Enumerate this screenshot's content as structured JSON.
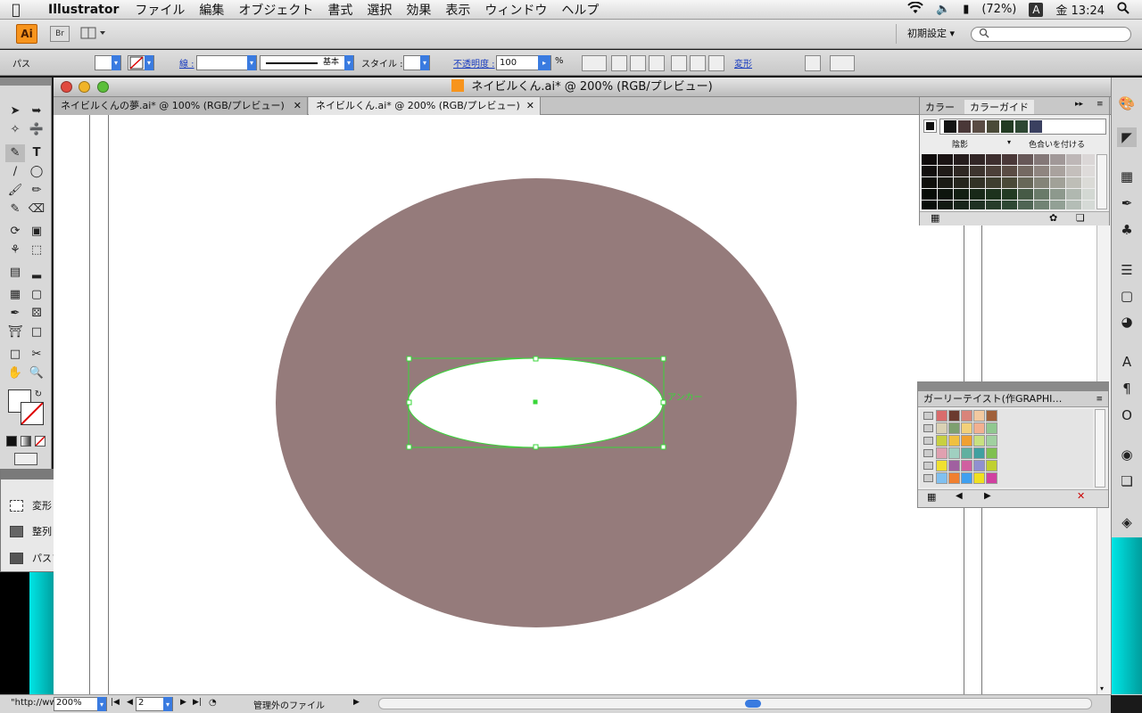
{
  "menubar": {
    "app_name": "Illustrator",
    "menus": [
      "ファイル",
      "編集",
      "オブジェクト",
      "書式",
      "選択",
      "効果",
      "表示",
      "ウィンドウ",
      "ヘルプ"
    ],
    "battery": "(72%)",
    "input_mode": "A",
    "clock": "金 13:24"
  },
  "appbar": {
    "logo": "Ai",
    "bridge": "Br",
    "workspace": "初期設定 ▾"
  },
  "control": {
    "selection_type": "パス",
    "stroke_label": "線 :",
    "stroke_style": "基本",
    "style_label": "スタイル :",
    "opacity_label": "不透明度 :",
    "opacity_value": "100",
    "percent": "%",
    "transform_link": "変形"
  },
  "document": {
    "title": "ネイビルくん.ai* @ 200% (RGB/プレビュー)",
    "tabs": [
      {
        "label": "ネイビルくんの夢.ai* @ 100% (RGB/プレビュー)",
        "close": "✕"
      },
      {
        "label": "ネイビルくん.ai* @ 200% (RGB/プレビュー)",
        "close": "✕"
      }
    ],
    "anchor_label": "アンカー",
    "big_ellipse_color": "#957b7b",
    "selection_color": "#39d639"
  },
  "status": {
    "url": "\"http://ww",
    "zoom": "200%",
    "page": "2",
    "info": "管理外のファイル"
  },
  "flyout": {
    "items": [
      "変形",
      "整列",
      "パスファインダ"
    ]
  },
  "color_panel": {
    "tab_color": "カラー",
    "tab_guide": "カラーガイド",
    "left_label": "陰影",
    "right_label": "色合いを付ける",
    "harmony_colors": [
      "#141414",
      "#4a3838",
      "#5a4c44",
      "#4a4a38",
      "#233b23",
      "#2e4833",
      "#3a4060"
    ]
  },
  "swatch_panel": {
    "title": "ガーリーテイスト(作GRAPHI…",
    "colors": [
      [
        "#d96c6c",
        "#6b3b2f",
        "#d9847a",
        "#f2c9a0",
        "#a0603a"
      ],
      [
        "#d9d1b4",
        "#7ea070",
        "#f2d07a",
        "#f2b090",
        "#90c890"
      ],
      [
        "#c8d040",
        "#f0c040",
        "#f0a030",
        "#c8e080",
        "#a0d0a0"
      ],
      [
        "#e0a0b0",
        "#a0d0c0",
        "#60b0a0",
        "#40a0a0",
        "#80c050"
      ],
      [
        "#f0e030",
        "#a060a0",
        "#d060a0",
        "#9090d0",
        "#c0d030"
      ],
      [
        "#80c0f0",
        "#f08030",
        "#40a0f0",
        "#f0e020",
        "#d040a0"
      ]
    ]
  }
}
